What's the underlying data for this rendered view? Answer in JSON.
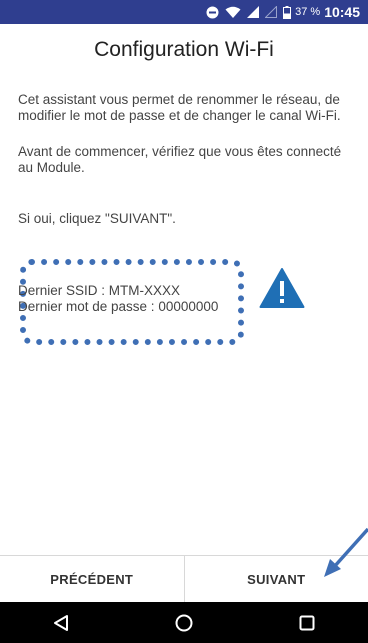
{
  "status_bar": {
    "battery_percent": "37 %",
    "time": "10:45",
    "icons": [
      "do-not-disturb-icon",
      "wifi-icon",
      "signal-icon",
      "signal-empty-icon",
      "battery-icon"
    ]
  },
  "title": "Configuration Wi-Fi",
  "paragraphs": [
    "Cet assistant vous permet de renommer le réseau, de modifier le mot de passe et de changer le canal Wi-Fi.",
    "Avant de commencer, vérifiez que vous êtes connecté au Module.",
    "Si oui, cliquez \"SUIVANT\"."
  ],
  "info": {
    "ssid_line": "Dernier SSID : MTM-XXXX",
    "password_line": "Dernier mot de passe : 00000000",
    "warning_icon": "warning-icon",
    "accent_color": "#3f6fb5"
  },
  "buttons": {
    "previous": "PRÉCÉDENT",
    "next": "SUIVANT"
  },
  "nav": {
    "icons": [
      "back-icon",
      "home-icon",
      "recents-icon"
    ]
  },
  "colors": {
    "status_bar": "#2f3e8f",
    "nav_bar": "#000000",
    "warning": "#1f6fb5"
  }
}
